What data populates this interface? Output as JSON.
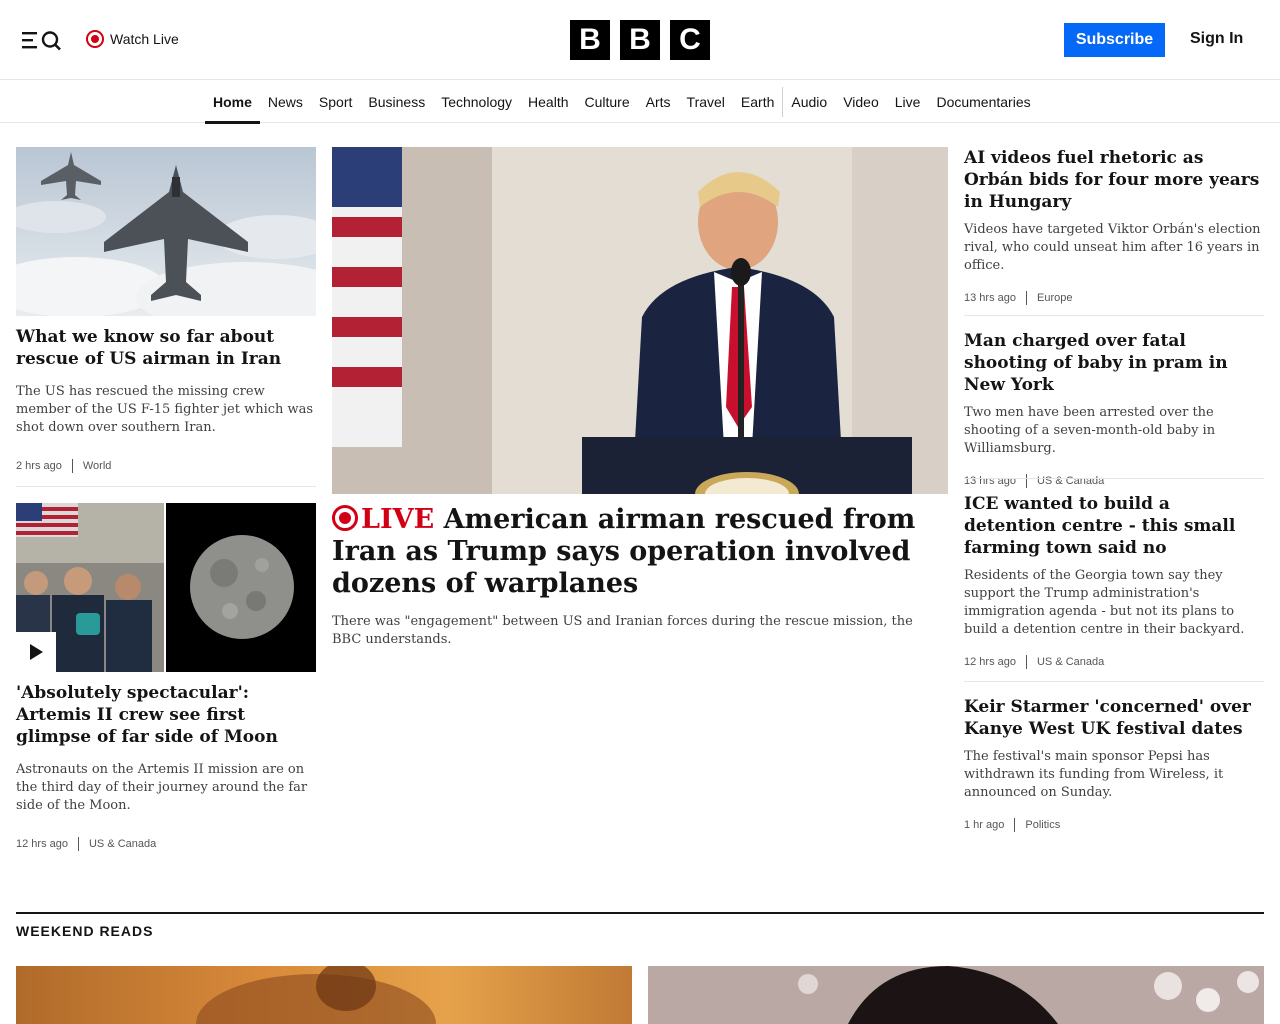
{
  "header": {
    "watch_live": "Watch Live",
    "logo_letters": [
      "B",
      "B",
      "C"
    ],
    "subscribe": "Subscribe",
    "sign_in": "Sign In"
  },
  "nav": {
    "items": [
      "Home",
      "News",
      "Sport",
      "Business",
      "Technology",
      "Health",
      "Culture",
      "Arts",
      "Travel",
      "Earth",
      "Audio",
      "Video",
      "Live",
      "Documentaries"
    ],
    "active": "Home"
  },
  "left": {
    "story1": {
      "headline": "What we know so far about rescue of US airman in Iran",
      "summary": "The US has rescued the missing crew member of the US F-15 fighter jet which was shot down over southern Iran.",
      "time": "2 hrs ago",
      "section": "World"
    },
    "story2": {
      "headline": "'Absolutely spectacular': Artemis II crew see first glimpse of far side of Moon",
      "summary": "Astronauts on the Artemis II mission are on the third day of their journey around the far side of the Moon.",
      "time": "12 hrs ago",
      "section": "US & Canada"
    }
  },
  "main": {
    "live_label": "LIVE",
    "headline": "American airman rescued from Iran as Trump says operation involved dozens of warplanes",
    "summary": "There was \"engagement\" between US and Iranian forces during the rescue mission, the BBC understands."
  },
  "right": {
    "stories": [
      {
        "headline": "AI videos fuel rhetoric as Orbán bids for four more years in Hungary",
        "summary": "Videos have targeted Viktor Orbán's election rival, who could unseat him after 16 years in office.",
        "time": "13 hrs ago",
        "section": "Europe"
      },
      {
        "headline": "Man charged over fatal shooting of baby in pram in New York",
        "summary": "Two men have been arrested over the shooting of a seven-month-old baby in Williamsburg.",
        "time": "13 hrs ago",
        "section": "US & Canada"
      },
      {
        "headline": "ICE wanted to build a detention centre - this small farming town said no",
        "summary": "Residents of the Georgia town say they support the Trump administration's immigration agenda - but not its plans to build a detention centre in their backyard.",
        "time": "12 hrs ago",
        "section": "US & Canada"
      },
      {
        "headline": "Keir Starmer 'concerned' over Kanye West UK festival dates",
        "summary": "The festival's main sponsor Pepsi has withdrawn its funding from Wireless, it announced on Sunday.",
        "time": "1 hr ago",
        "section": "Politics"
      }
    ]
  },
  "weekend_reads": {
    "title": "WEEKEND READS"
  },
  "colors": {
    "subscribe_blue": "#0568f6",
    "live_red": "#d20014",
    "text": "#141414"
  },
  "icons": [
    "menu-icon",
    "search-icon",
    "live-dot-icon",
    "play-icon"
  ]
}
